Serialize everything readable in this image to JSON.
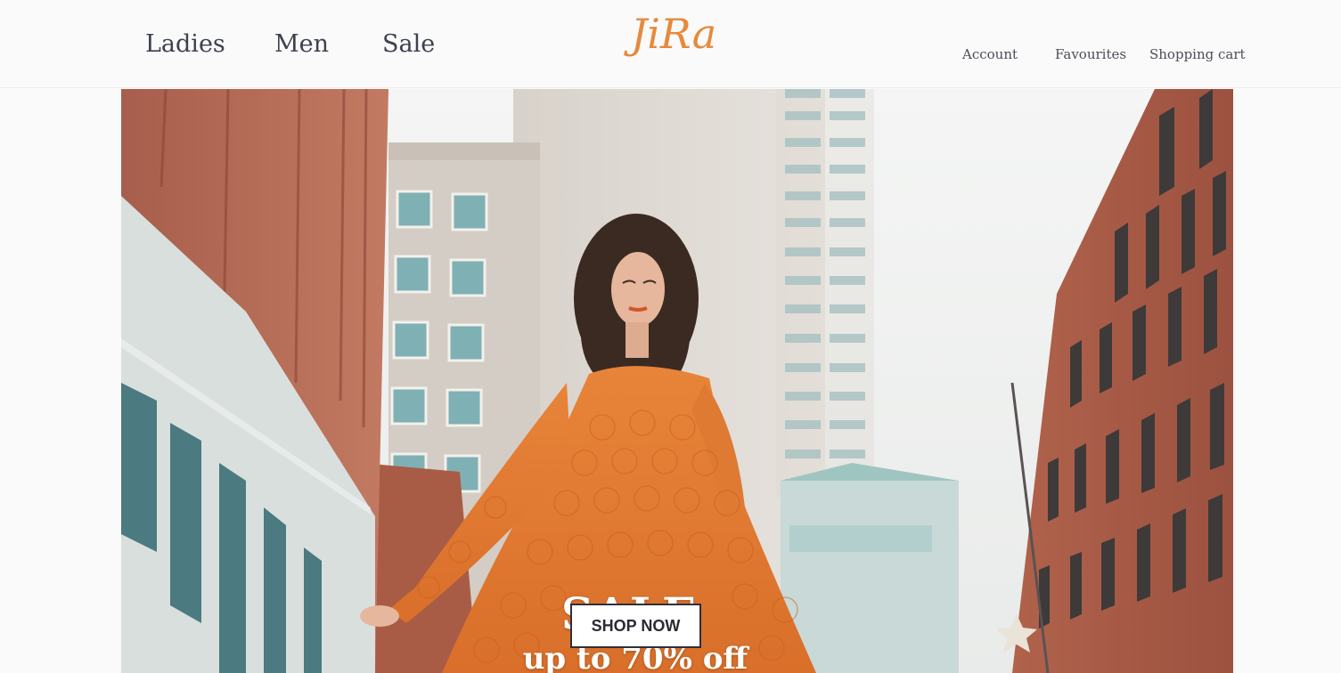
{
  "header": {
    "nav_left": [
      {
        "label": "Ladies"
      },
      {
        "label": "Men"
      },
      {
        "label": "Sale"
      }
    ],
    "logo_text": "JiRa",
    "nav_right": [
      {
        "label": "Account"
      },
      {
        "label": "Favourites"
      },
      {
        "label": "Shopping cart"
      }
    ]
  },
  "hero": {
    "title": "SALE",
    "subtitle": "up to 70% off",
    "cta_label": "SHOP NOW"
  },
  "colors": {
    "accent": "#e58a3c",
    "dress": "#e27b34",
    "brick": "#a45a45",
    "text": "#3d4150"
  }
}
